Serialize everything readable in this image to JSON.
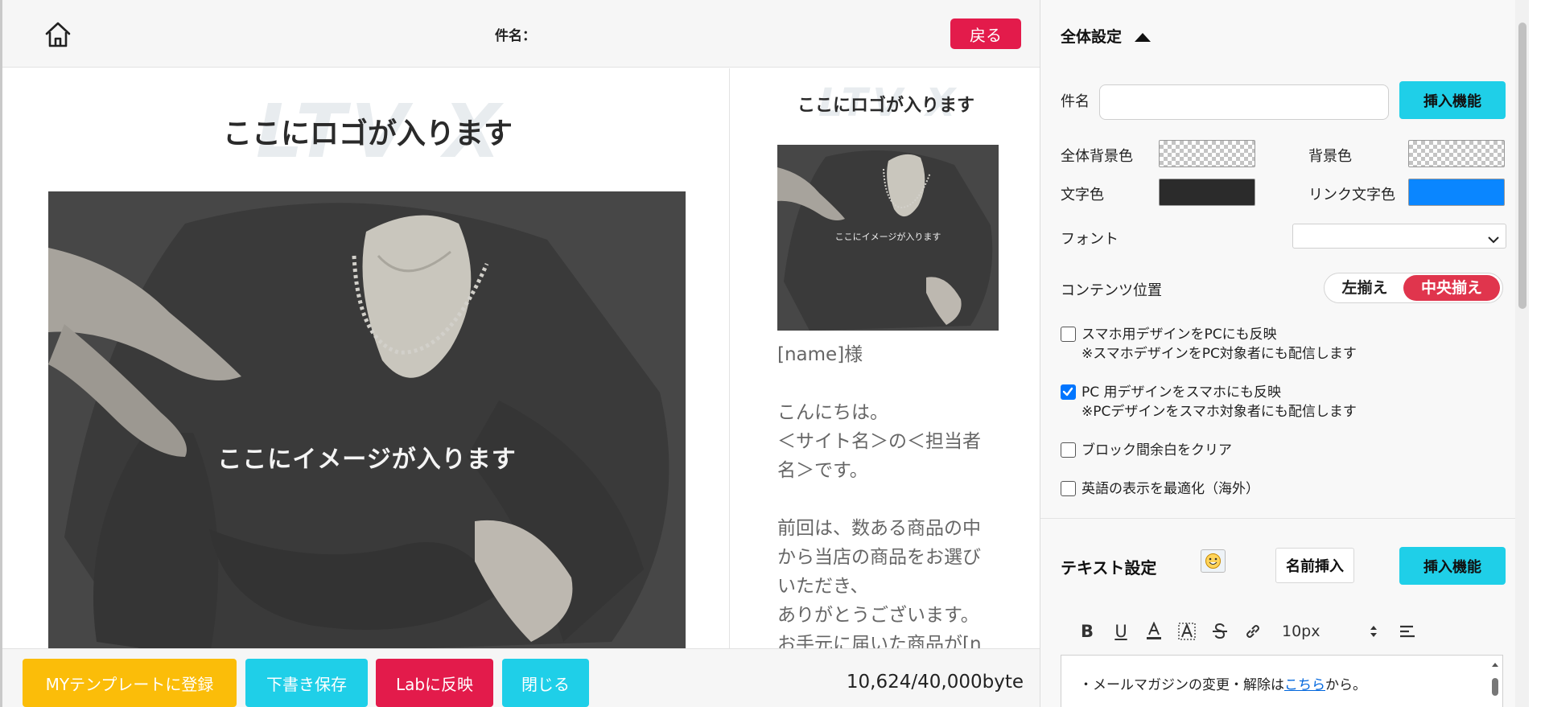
{
  "header": {
    "subject_label": "件名：",
    "back_label": "戻る"
  },
  "pc_preview": {
    "logo_watermark": "LTV X",
    "logo_placeholder": "ここにロゴが入ります",
    "image_placeholder": "ここにイメージが入ります"
  },
  "sp_preview": {
    "logo_watermark": "LTV X",
    "logo_placeholder": "ここにロゴが入ります",
    "image_placeholder": "ここにイメージが入ります",
    "lines": [
      "[name]様",
      "",
      "こんにちは。",
      "＜サイト名＞の＜担当者",
      "名＞です。",
      "",
      "前回は、数ある商品の中",
      "から当店の商品をお選び",
      "いただき、",
      "ありがとうございます。",
      "お手元に届いた商品が[n"
    ]
  },
  "footer": {
    "my_template_label": "MYテンプレートに登録",
    "draft_save_label": "下書き保存",
    "lab_reflect_label": "Labに反映",
    "close_label": "閉じる",
    "byte_count": "10,624/40,000byte"
  },
  "settings": {
    "title": "全体設定",
    "subject_label": "件名",
    "subject_value": "",
    "insert_label": "挿入機能",
    "overall_bg_label": "全体背景色",
    "bg_label": "背景色",
    "text_color_label": "文字色",
    "link_color_label": "リンク文字色",
    "font_label": "フォント",
    "font_value": "",
    "content_position_label": "コンテンツ位置",
    "align_left_label": "左揃え",
    "align_center_label": "中央揃え",
    "checkboxes": [
      {
        "line1": "スマホ用デザインをPCにも反映",
        "line2": "※スマホデザインをPC対象者にも配信します",
        "checked": false
      },
      {
        "line1": "PC 用デザインをスマホにも反映",
        "line2": "※PCデザインをスマホ対象者にも配信します",
        "checked": true
      },
      {
        "line1": "ブロック間余白をクリア",
        "line2": "",
        "checked": false
      },
      {
        "line1": "英語の表示を最適化（海外）",
        "line2": "",
        "checked": false
      }
    ]
  },
  "text_settings": {
    "title": "テキスト設定",
    "name_insert_label": "名前挿入",
    "insert_label": "挿入機能",
    "font_size": "10px",
    "editor_prefix": "・メールマガジンの変更・解除は",
    "editor_link": "こちら",
    "editor_suffix": "から。"
  },
  "colors": {
    "accent_red": "#e31b4b",
    "accent_cyan": "#1fcfe8",
    "accent_yellow": "#fbbd09",
    "text_color_swatch": "#2b2b2b",
    "link_color_swatch": "#0a86ff"
  },
  "icons": [
    "home-icon",
    "caret-up-icon",
    "emoji-icon",
    "bold-icon",
    "underline-icon",
    "font-color-icon",
    "highlight-icon",
    "strikethrough-icon",
    "link-icon",
    "size-stepper-icon",
    "align-left-icon",
    "chevron-down-icon"
  ]
}
